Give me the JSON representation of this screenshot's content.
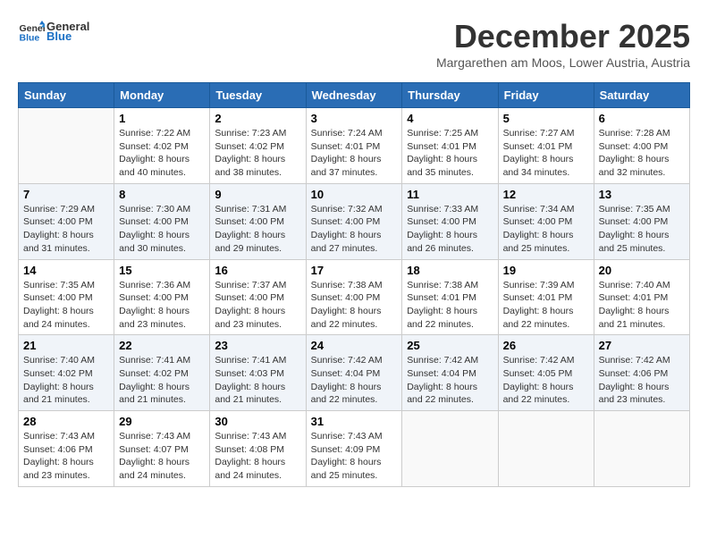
{
  "header": {
    "logo_general": "General",
    "logo_blue": "Blue",
    "month_title": "December 2025",
    "subtitle": "Margarethen am Moos, Lower Austria, Austria"
  },
  "columns": [
    "Sunday",
    "Monday",
    "Tuesday",
    "Wednesday",
    "Thursday",
    "Friday",
    "Saturday"
  ],
  "weeks": [
    [
      {
        "day": "",
        "info": ""
      },
      {
        "day": "1",
        "info": "Sunrise: 7:22 AM\nSunset: 4:02 PM\nDaylight: 8 hours\nand 40 minutes."
      },
      {
        "day": "2",
        "info": "Sunrise: 7:23 AM\nSunset: 4:02 PM\nDaylight: 8 hours\nand 38 minutes."
      },
      {
        "day": "3",
        "info": "Sunrise: 7:24 AM\nSunset: 4:01 PM\nDaylight: 8 hours\nand 37 minutes."
      },
      {
        "day": "4",
        "info": "Sunrise: 7:25 AM\nSunset: 4:01 PM\nDaylight: 8 hours\nand 35 minutes."
      },
      {
        "day": "5",
        "info": "Sunrise: 7:27 AM\nSunset: 4:01 PM\nDaylight: 8 hours\nand 34 minutes."
      },
      {
        "day": "6",
        "info": "Sunrise: 7:28 AM\nSunset: 4:00 PM\nDaylight: 8 hours\nand 32 minutes."
      }
    ],
    [
      {
        "day": "7",
        "info": "Sunrise: 7:29 AM\nSunset: 4:00 PM\nDaylight: 8 hours\nand 31 minutes."
      },
      {
        "day": "8",
        "info": "Sunrise: 7:30 AM\nSunset: 4:00 PM\nDaylight: 8 hours\nand 30 minutes."
      },
      {
        "day": "9",
        "info": "Sunrise: 7:31 AM\nSunset: 4:00 PM\nDaylight: 8 hours\nand 29 minutes."
      },
      {
        "day": "10",
        "info": "Sunrise: 7:32 AM\nSunset: 4:00 PM\nDaylight: 8 hours\nand 27 minutes."
      },
      {
        "day": "11",
        "info": "Sunrise: 7:33 AM\nSunset: 4:00 PM\nDaylight: 8 hours\nand 26 minutes."
      },
      {
        "day": "12",
        "info": "Sunrise: 7:34 AM\nSunset: 4:00 PM\nDaylight: 8 hours\nand 25 minutes."
      },
      {
        "day": "13",
        "info": "Sunrise: 7:35 AM\nSunset: 4:00 PM\nDaylight: 8 hours\nand 25 minutes."
      }
    ],
    [
      {
        "day": "14",
        "info": "Sunrise: 7:35 AM\nSunset: 4:00 PM\nDaylight: 8 hours\nand 24 minutes."
      },
      {
        "day": "15",
        "info": "Sunrise: 7:36 AM\nSunset: 4:00 PM\nDaylight: 8 hours\nand 23 minutes."
      },
      {
        "day": "16",
        "info": "Sunrise: 7:37 AM\nSunset: 4:00 PM\nDaylight: 8 hours\nand 23 minutes."
      },
      {
        "day": "17",
        "info": "Sunrise: 7:38 AM\nSunset: 4:00 PM\nDaylight: 8 hours\nand 22 minutes."
      },
      {
        "day": "18",
        "info": "Sunrise: 7:38 AM\nSunset: 4:01 PM\nDaylight: 8 hours\nand 22 minutes."
      },
      {
        "day": "19",
        "info": "Sunrise: 7:39 AM\nSunset: 4:01 PM\nDaylight: 8 hours\nand 22 minutes."
      },
      {
        "day": "20",
        "info": "Sunrise: 7:40 AM\nSunset: 4:01 PM\nDaylight: 8 hours\nand 21 minutes."
      }
    ],
    [
      {
        "day": "21",
        "info": "Sunrise: 7:40 AM\nSunset: 4:02 PM\nDaylight: 8 hours\nand 21 minutes."
      },
      {
        "day": "22",
        "info": "Sunrise: 7:41 AM\nSunset: 4:02 PM\nDaylight: 8 hours\nand 21 minutes."
      },
      {
        "day": "23",
        "info": "Sunrise: 7:41 AM\nSunset: 4:03 PM\nDaylight: 8 hours\nand 21 minutes."
      },
      {
        "day": "24",
        "info": "Sunrise: 7:42 AM\nSunset: 4:04 PM\nDaylight: 8 hours\nand 22 minutes."
      },
      {
        "day": "25",
        "info": "Sunrise: 7:42 AM\nSunset: 4:04 PM\nDaylight: 8 hours\nand 22 minutes."
      },
      {
        "day": "26",
        "info": "Sunrise: 7:42 AM\nSunset: 4:05 PM\nDaylight: 8 hours\nand 22 minutes."
      },
      {
        "day": "27",
        "info": "Sunrise: 7:42 AM\nSunset: 4:06 PM\nDaylight: 8 hours\nand 23 minutes."
      }
    ],
    [
      {
        "day": "28",
        "info": "Sunrise: 7:43 AM\nSunset: 4:06 PM\nDaylight: 8 hours\nand 23 minutes."
      },
      {
        "day": "29",
        "info": "Sunrise: 7:43 AM\nSunset: 4:07 PM\nDaylight: 8 hours\nand 24 minutes."
      },
      {
        "day": "30",
        "info": "Sunrise: 7:43 AM\nSunset: 4:08 PM\nDaylight: 8 hours\nand 24 minutes."
      },
      {
        "day": "31",
        "info": "Sunrise: 7:43 AM\nSunset: 4:09 PM\nDaylight: 8 hours\nand 25 minutes."
      },
      {
        "day": "",
        "info": ""
      },
      {
        "day": "",
        "info": ""
      },
      {
        "day": "",
        "info": ""
      }
    ]
  ]
}
